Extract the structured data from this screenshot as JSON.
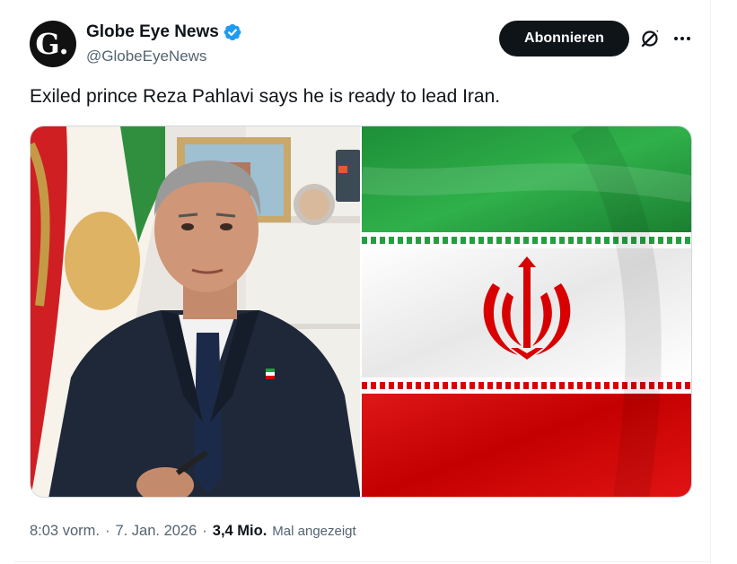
{
  "author": {
    "avatar_letter": "G.",
    "display_name": "Globe Eye News",
    "handle": "@GlobeEyeNews",
    "verified": true,
    "verified_color": "#1d9bf0"
  },
  "actions": {
    "subscribe_label": "Abonnieren",
    "grok_icon": "grok-slash-icon",
    "more_icon": "more-dots-icon"
  },
  "tweet": {
    "text": "Exiled prince Reza Pahlavi says he is ready to lead Iran."
  },
  "media": {
    "left_image": "photo-of-man-in-suit-at-desk",
    "right_image": "iranian-flag-waving",
    "flag_colors": {
      "green": "#239f40",
      "white": "#ffffff",
      "red": "#da0000"
    }
  },
  "meta": {
    "time": "8:03 vorm.",
    "separator": "·",
    "date": "7. Jan. 2026",
    "views_count": "3,4 Mio.",
    "views_label": "Mal angezeigt"
  }
}
